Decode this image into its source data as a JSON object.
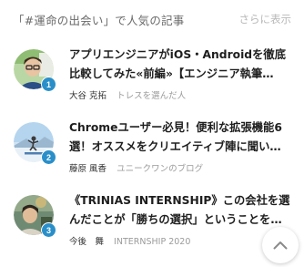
{
  "header": {
    "title": "「#運命の出会い」で人気の記事",
    "more_label": "さらに表示"
  },
  "articles": [
    {
      "rank": "1",
      "title_line1": "アプリエンジニアがiOS・Androidを徹底",
      "title_line2": "比較してみた«前編»【エンジニア執筆…",
      "author": "大谷 克拓",
      "blog": "トレスを選んだ人"
    },
    {
      "rank": "2",
      "title_line1": "Chromeユーザー必見！便利な拡張機能6",
      "title_line2": "選！オススメをクリエイティブ陣に聞い…",
      "author": "藤原 風香",
      "blog": "ユニークワンのブログ"
    },
    {
      "rank": "3",
      "title_line1": "《TRINIAS INTERNSHIP》この会社を選",
      "title_line2": "んだことが「勝ちの選択」ということを…",
      "author": "今後　舞",
      "blog": "INTERNSHIP 2020"
    }
  ],
  "colors": {
    "rank_badge": "#2a8fc9",
    "muted_text": "#9b9b9b"
  },
  "icons": {
    "scroll_top": "chevron-up-icon"
  }
}
